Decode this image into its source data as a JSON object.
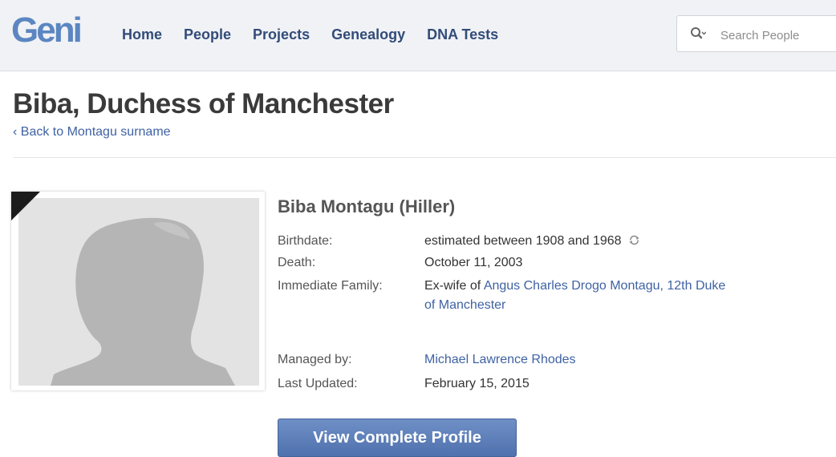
{
  "header": {
    "logo": "Geni",
    "nav": [
      "Home",
      "People",
      "Projects",
      "Genealogy",
      "DNA Tests"
    ],
    "search_placeholder": "Search People"
  },
  "page": {
    "title": "Biba, Duchess of Manchester",
    "back_link": "‹ Back to Montagu surname"
  },
  "profile": {
    "name": "Biba Montagu (Hiller)",
    "birthdate_label": "Birthdate:",
    "birthdate_value": "estimated between 1908 and 1968",
    "death_label": "Death:",
    "death_value": "October 11, 2003",
    "family_label": "Immediate Family:",
    "family_prefix": "Ex-wife of ",
    "family_link": "Angus Charles Drogo Montagu, 12th Duke of Manchester",
    "managed_label": "Managed by:",
    "managed_value": "Michael Lawrence Rhodes",
    "updated_label": "Last Updated:",
    "updated_value": "February 15, 2015",
    "cta_label": "View Complete Profile"
  },
  "icons": {
    "search": "magnifier-icon",
    "refresh": "refresh-icon",
    "deceased": "black-ribbon-icon",
    "avatar": "female-silhouette"
  },
  "colors": {
    "brand": "#5b86c1",
    "nav_text": "#324c79",
    "link": "#3f62a3",
    "button": "#5a7bb8"
  }
}
